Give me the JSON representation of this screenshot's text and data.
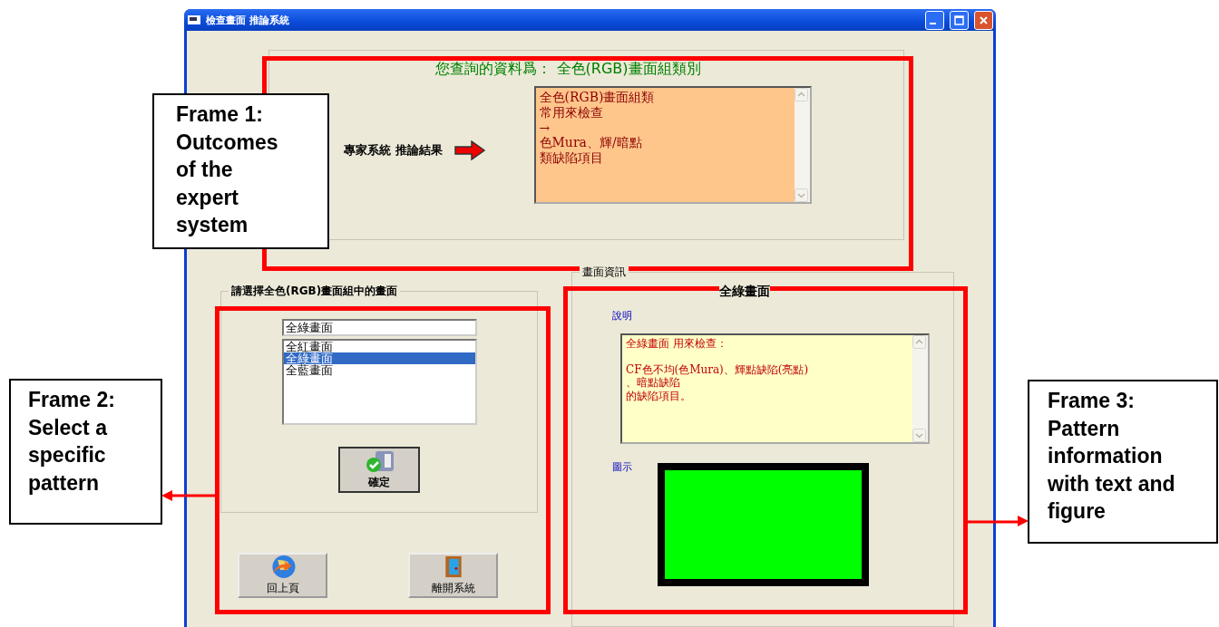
{
  "window": {
    "title": "檢查畫面 推論系統"
  },
  "query": "您查詢的資料爲： 全色(RGB)畫面組類別",
  "inference": {
    "label": "專家系統 推論結果",
    "result": [
      "全色(RGB)畫面組類",
      "常用來檢查",
      "→",
      "色Mura、輝/暗點",
      "類缺陷項目"
    ]
  },
  "selection": {
    "legend": "請選擇全色(RGB)畫面組中的畫面",
    "combo_value": "全綠畫面",
    "items": [
      {
        "label": "全紅畫面",
        "selected": false
      },
      {
        "label": "全綠畫面",
        "selected": true
      },
      {
        "label": "全藍畫面",
        "selected": false
      }
    ],
    "ok_button": "確定"
  },
  "nav_buttons": [
    {
      "kind": "back",
      "label": "回上頁"
    },
    {
      "kind": "exit",
      "label": "離開系統"
    }
  ],
  "info": {
    "legend": "畫面資訊",
    "heading": "全綠畫面",
    "description_label": "說明",
    "description": [
      "全綠畫面 用來檢查：",
      "CF色不均(色Mura)、輝點缺陷(亮點)",
      "、暗點缺陷",
      "的缺陷項目。"
    ],
    "figure_label": "圖示"
  },
  "annotations": [
    {
      "text": "Frame 1: Outcomes of the expert system"
    },
    {
      "text": "Frame 2: Select a specific pattern"
    },
    {
      "text": "Frame 3: Pattern information with text and figure"
    }
  ]
}
